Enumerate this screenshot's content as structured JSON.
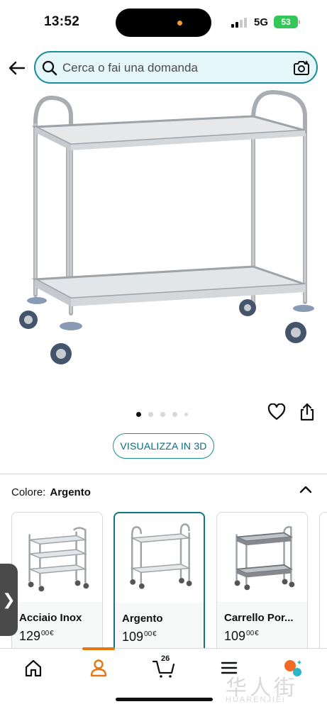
{
  "status_bar": {
    "time": "13:52",
    "network": "5G",
    "battery": "53"
  },
  "search": {
    "placeholder": "Cerca o fai una domanda",
    "icon": "search-icon",
    "camera_icon": "camera-icon"
  },
  "product": {
    "image_icon": "stainless-steel-trolley-image",
    "gallery_current_index": 1,
    "gallery_total": 5,
    "view_3d_label": "VISUALIZZA IN 3D"
  },
  "color_selector": {
    "label": "Colore:",
    "selected": "Argento",
    "variants": [
      {
        "name": "Acciaio Inox",
        "price_whole": "129",
        "price_fraction": "00",
        "currency": "€",
        "selected": false
      },
      {
        "name": "Argento",
        "price_whole": "109",
        "price_fraction": "00",
        "currency": "€",
        "selected": true
      },
      {
        "name": "Carrello Por...",
        "price_whole": "109",
        "price_fraction": "00",
        "currency": "€",
        "selected": false
      }
    ]
  },
  "bottom_nav": {
    "items": [
      "home-icon",
      "account-icon",
      "cart-icon",
      "menu-icon",
      "rufus-ai-icon"
    ],
    "active": "account-icon",
    "cart_count": "26"
  },
  "watermark": {
    "cn": "华人街",
    "en": "HUARENJIEi"
  },
  "colors": {
    "accent_teal": "#1e8f97",
    "search_bg": "#e6f7fb",
    "active_orange": "#e47911",
    "battery_green": "#33c759"
  }
}
